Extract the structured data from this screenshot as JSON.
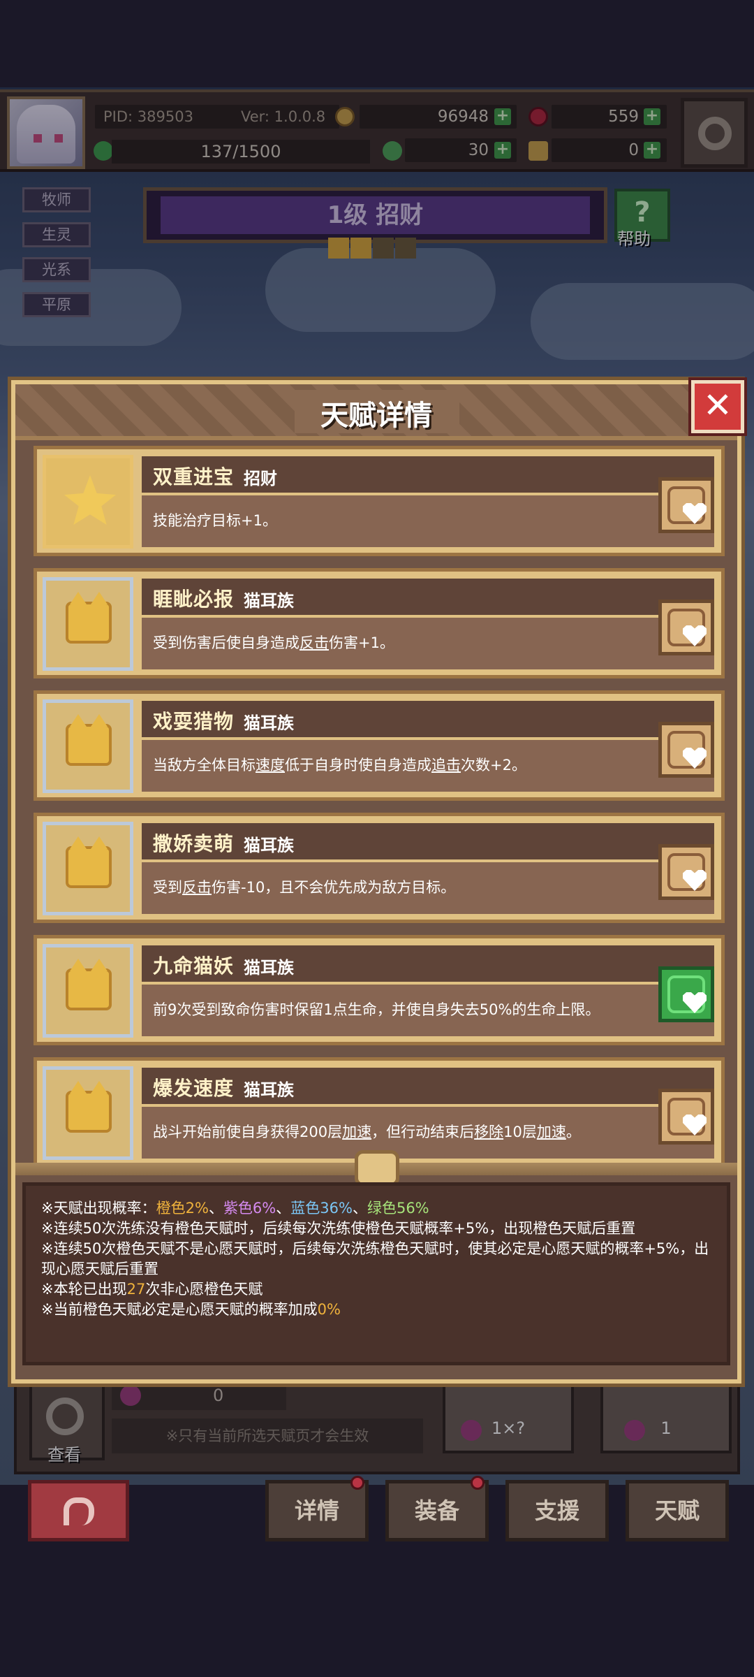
{
  "header": {
    "pid": "PID: 389503",
    "version": "Ver: 1.0.0.8",
    "gold": "96948",
    "gems": "559",
    "exp": "137/1500",
    "clover": "30",
    "key": "0"
  },
  "side_tags": [
    "牧师",
    "生灵",
    "光系",
    "平原"
  ],
  "hero": {
    "level_title": "1级 招财",
    "stars_filled": 2,
    "stars_total": 4,
    "help_label": "帮助"
  },
  "modal": {
    "title": "天赋详情",
    "close_symbol": "✕",
    "talents": [
      {
        "name": "双重进宝",
        "tag": "招财",
        "desc_parts": [
          {
            "t": "技能治疗目标+1。"
          }
        ],
        "wished": false,
        "icon": "star-icon"
      },
      {
        "name": "睚眦必报",
        "tag": "猫耳族",
        "desc_parts": [
          {
            "t": "受到伤害后使自身造成"
          },
          {
            "t": "反击",
            "u": true
          },
          {
            "t": "伤害+1。"
          }
        ],
        "wished": false,
        "icon": "cat-icon"
      },
      {
        "name": "戏耍猎物",
        "tag": "猫耳族",
        "desc_parts": [
          {
            "t": "当敌方全体目标"
          },
          {
            "t": "速度",
            "u": true
          },
          {
            "t": "低于自身时使自身造成"
          },
          {
            "t": "追击",
            "u": true
          },
          {
            "t": "次数+2。"
          }
        ],
        "wished": false,
        "icon": "cat-icon"
      },
      {
        "name": "撒娇卖萌",
        "tag": "猫耳族",
        "desc_parts": [
          {
            "t": "受到"
          },
          {
            "t": "反击",
            "u": true
          },
          {
            "t": "伤害-10，且不会优先成为敌方目标。"
          }
        ],
        "wished": false,
        "icon": "cat-icon"
      },
      {
        "name": "九命猫妖",
        "tag": "猫耳族",
        "desc_parts": [
          {
            "t": "前9次受到致命伤害时保留1点生命，并使自身失去50%的生命上限。"
          }
        ],
        "wished": true,
        "icon": "cat-icon"
      },
      {
        "name": "爆发速度",
        "tag": "猫耳族",
        "desc_parts": [
          {
            "t": "战斗开始前使自身获得200层"
          },
          {
            "t": "加速",
            "u": true
          },
          {
            "t": "，但行动结束后"
          },
          {
            "t": "移除",
            "u": true
          },
          {
            "t": "10层"
          },
          {
            "t": "加速",
            "u": true
          },
          {
            "t": "。"
          }
        ],
        "wished": false,
        "icon": "cat-icon"
      }
    ],
    "rules": {
      "line1_prefix": "※天赋出现概率：",
      "orange": "橙色2%",
      "sep": "、",
      "purple": "紫色6%",
      "blue": "蓝色36%",
      "green": "绿色56%",
      "line2": "※连续50次洗练没有橙色天赋时，后续每次洗练使橙色天赋概率+5%，出现橙色天赋后重置",
      "line3": "※连续50次橙色天赋不是心愿天赋时，后续每次洗练橙色天赋时，使其必定是心愿天赋的概率+5%，出现心愿天赋后重置",
      "line4_prefix": "※本轮已出现",
      "line4_count": "27",
      "line4_suffix": "次非心愿橙色天赋",
      "line5_prefix": "※当前橙色天赋必定是心愿天赋的概率加成",
      "line5_value": "0%"
    }
  },
  "bottom": {
    "view_label": "查看",
    "potion_count": "0",
    "hint": "※只有当前所选天赋页才会生效",
    "auto_count": "1×?",
    "refine_count": "1"
  },
  "nav": {
    "details": "详情",
    "equip": "装备",
    "support": "支援",
    "talent": "天赋"
  },
  "colors": {
    "orange": "#f0b33c",
    "purple": "#d58af0",
    "blue": "#7bc6f5",
    "green": "#a6e37a",
    "wish_active": "#3aa84a"
  }
}
